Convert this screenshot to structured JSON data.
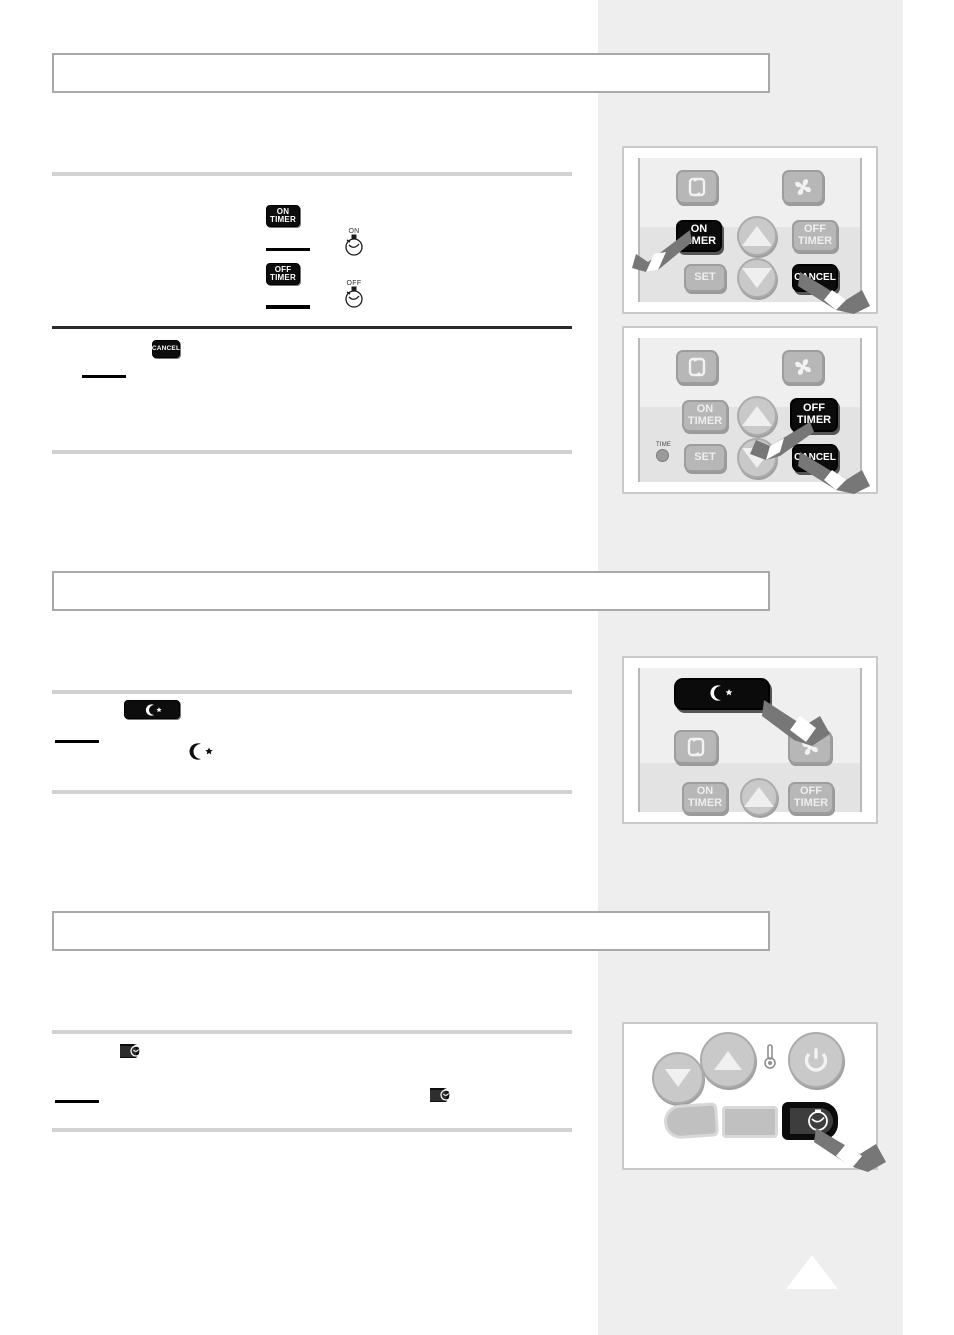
{
  "document": {
    "type": "appliance-manual-page",
    "headings": [
      "",
      "",
      ""
    ],
    "body_text": ""
  },
  "colors": {
    "sidebar": "#eeeeee",
    "heading_border": "#a8a8a8",
    "rule_light": "#d2d2d2",
    "rule_dark": "#2b2b2b",
    "key_black": "#0d0d0d",
    "button_gray": "#b7b7b7",
    "panel_border": "#c9c9c9",
    "remote_body": "#ececec"
  },
  "sections": [
    {
      "id": "timer-set",
      "heading": "",
      "inline_icons": [
        {
          "name": "on-timer-key",
          "line1": "ON",
          "line2": "TIMER"
        },
        {
          "name": "timer-display-on",
          "label": "ON"
        },
        {
          "name": "off-timer-key",
          "line1": "OFF",
          "line2": "TIMER"
        },
        {
          "name": "timer-display-off",
          "label": "OFF"
        }
      ]
    },
    {
      "id": "timer-cancel",
      "heading": "",
      "inline_icons": [
        {
          "name": "cancel-key",
          "line1": "CANCEL"
        }
      ]
    },
    {
      "id": "sleep-mode",
      "heading": "",
      "inline_icons": [
        {
          "name": "sleep-key",
          "label": "moon-star"
        },
        {
          "name": "sleep-display-symbol",
          "label": "moon-star"
        }
      ]
    },
    {
      "id": "unit-timer",
      "heading": "",
      "inline_icons": [
        {
          "name": "unit-timer-key",
          "label": "timer"
        },
        {
          "name": "unit-timer-key-2",
          "label": "timer"
        }
      ]
    }
  ],
  "figures": [
    {
      "id": "figure-on-timer",
      "caption": "",
      "buttons": [
        {
          "name": "swing-button",
          "icon": "swing-icon",
          "state": "normal"
        },
        {
          "name": "fan-speed-button",
          "icon": "fan-icon",
          "state": "normal"
        },
        {
          "name": "on-timer-button",
          "line1": "ON",
          "line2": "TIMER",
          "state": "highlighted"
        },
        {
          "name": "temp-up-button",
          "icon": "triangle-up-icon",
          "state": "normal"
        },
        {
          "name": "off-timer-button",
          "line1": "OFF",
          "line2": "TIMER",
          "state": "normal"
        },
        {
          "name": "set-button",
          "line1": "SET",
          "state": "normal"
        },
        {
          "name": "temp-down-button",
          "icon": "triangle-down-icon",
          "state": "normal"
        },
        {
          "name": "cancel-button",
          "line1": "CANCEL",
          "state": "highlighted"
        }
      ],
      "pointers": 2
    },
    {
      "id": "figure-off-timer",
      "caption": "",
      "indicator": {
        "name": "time-indicator",
        "label": "TIME"
      },
      "buttons": [
        {
          "name": "swing-button",
          "icon": "swing-icon",
          "state": "normal"
        },
        {
          "name": "fan-speed-button",
          "icon": "fan-icon",
          "state": "normal"
        },
        {
          "name": "on-timer-button",
          "line1": "ON",
          "line2": "TIMER",
          "state": "normal"
        },
        {
          "name": "temp-up-button",
          "icon": "triangle-up-icon",
          "state": "normal"
        },
        {
          "name": "off-timer-button",
          "line1": "OFF",
          "line2": "TIMER",
          "state": "highlighted"
        },
        {
          "name": "set-button",
          "line1": "SET",
          "state": "normal"
        },
        {
          "name": "temp-down-button",
          "icon": "triangle-down-icon",
          "state": "normal"
        },
        {
          "name": "cancel-button",
          "line1": "CANCEL",
          "state": "highlighted"
        }
      ],
      "pointers": 2
    },
    {
      "id": "figure-sleep-mode",
      "caption": "",
      "buttons": [
        {
          "name": "sleep-button",
          "icon": "moon-star-icon",
          "state": "highlighted"
        },
        {
          "name": "swing-button",
          "icon": "swing-icon",
          "state": "normal"
        },
        {
          "name": "fan-speed-button",
          "icon": "fan-icon",
          "state": "normal"
        },
        {
          "name": "on-timer-button",
          "line1": "ON",
          "line2": "TIMER",
          "state": "normal"
        },
        {
          "name": "temp-up-button",
          "icon": "triangle-up-icon",
          "state": "normal"
        },
        {
          "name": "off-timer-button",
          "line1": "OFF",
          "line2": "TIMER",
          "state": "normal"
        }
      ],
      "pointers": 1
    },
    {
      "id": "figure-unit-panel",
      "caption": "",
      "buttons": [
        {
          "name": "temp-down-button",
          "icon": "triangle-down-icon",
          "state": "normal"
        },
        {
          "name": "temp-up-button",
          "icon": "triangle-up-icon",
          "state": "normal"
        },
        {
          "name": "thermometer-indicator",
          "icon": "thermometer-icon",
          "state": "static"
        },
        {
          "name": "power-button",
          "icon": "power-icon",
          "state": "normal"
        },
        {
          "name": "left-vent-bar",
          "icon": "vent-bar",
          "state": "normal"
        },
        {
          "name": "center-vent-bar",
          "icon": "vent-bar",
          "state": "normal"
        },
        {
          "name": "unit-timer-button",
          "icon": "timer-icon",
          "state": "highlighted"
        }
      ],
      "pointers": 1
    }
  ],
  "page_marker": {
    "name": "page-nav-triangle",
    "direction": "up"
  }
}
